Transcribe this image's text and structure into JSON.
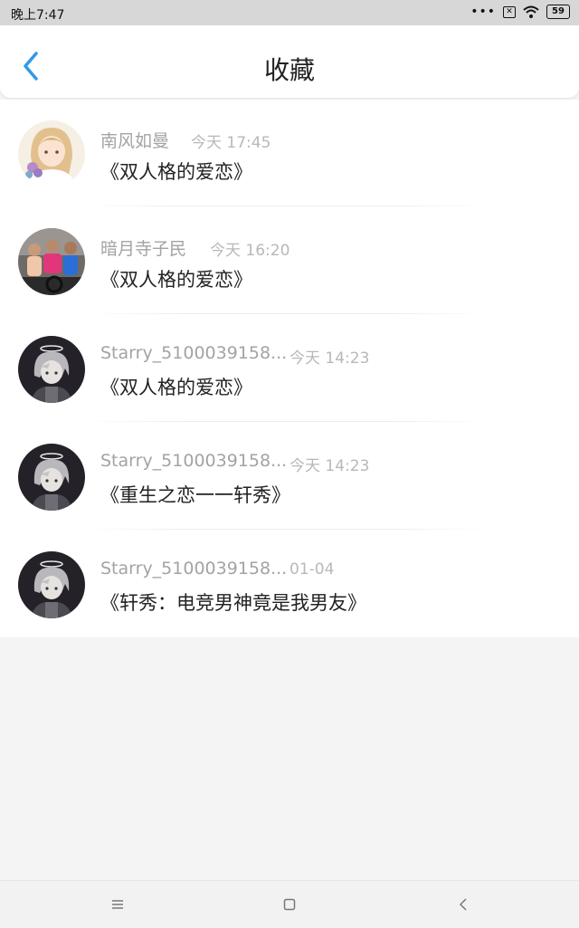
{
  "status_bar": {
    "time": "晚上7:47",
    "battery": "59"
  },
  "header": {
    "title": "收藏"
  },
  "items": [
    {
      "user": "南风如曼",
      "time": "今天 17:45",
      "title": "《双人格的爱恋》",
      "avatar": "anime-girl-avatar"
    },
    {
      "user": "暗月寺子民",
      "time": "今天 16:20",
      "title": "《双人格的爱恋》",
      "avatar": "fitness-photo-avatar"
    },
    {
      "user": "Starry_5100039158...",
      "time": "今天 14:23",
      "title": "《双人格的爱恋》",
      "avatar": "anime-boy-avatar"
    },
    {
      "user": "Starry_5100039158...",
      "time": "今天 14:23",
      "title": "《重生之恋一一轩秀》",
      "avatar": "anime-boy-avatar"
    },
    {
      "user": "Starry_5100039158...",
      "time": "01-04",
      "title": "《轩秀：电竞男神竟是我男友》",
      "avatar": "anime-boy-avatar"
    }
  ],
  "colors": {
    "accent": "#2f9ae8",
    "title_text": "#222222",
    "meta_text": "#a3a3a3"
  }
}
